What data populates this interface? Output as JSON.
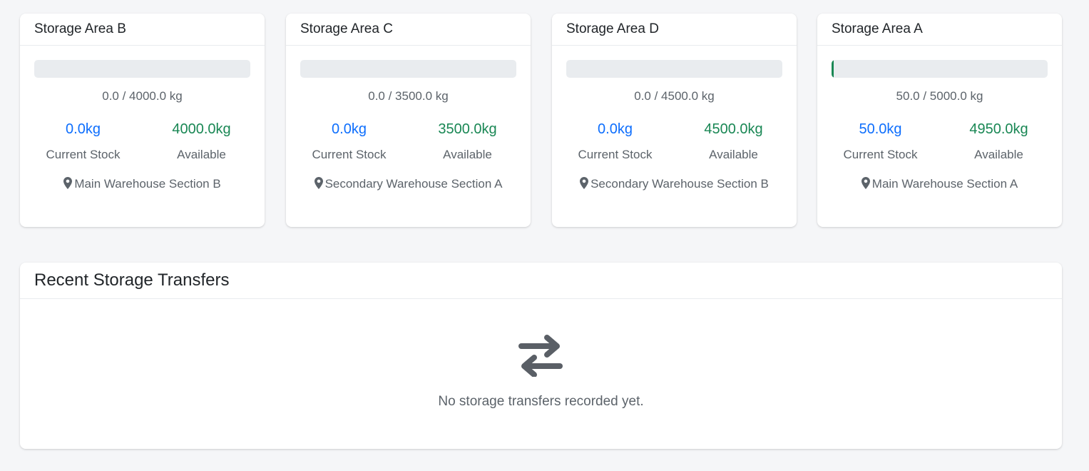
{
  "storage_areas": [
    {
      "name": "Storage Area B",
      "capacity_text": "0.0 / 4000.0 kg",
      "fill_fraction": 0.0,
      "current_stock": "0.0kg",
      "current_stock_label": "Current Stock",
      "available": "4000.0kg",
      "available_label": "Available",
      "location": "Main Warehouse Section B",
      "location_icon": "map-pin-icon"
    },
    {
      "name": "Storage Area C",
      "capacity_text": "0.0 / 3500.0 kg",
      "fill_fraction": 0.0,
      "current_stock": "0.0kg",
      "current_stock_label": "Current Stock",
      "available": "3500.0kg",
      "available_label": "Available",
      "location": "Secondary Warehouse Section A",
      "location_icon": "map-pin-icon"
    },
    {
      "name": "Storage Area D",
      "capacity_text": "0.0 / 4500.0 kg",
      "fill_fraction": 0.0,
      "current_stock": "0.0kg",
      "current_stock_label": "Current Stock",
      "available": "4500.0kg",
      "available_label": "Available",
      "location": "Secondary Warehouse Section B",
      "location_icon": "map-pin-icon"
    },
    {
      "name": "Storage Area A",
      "capacity_text": "50.0 / 5000.0 kg",
      "fill_fraction": 0.01,
      "current_stock": "50.0kg",
      "current_stock_label": "Current Stock",
      "available": "4950.0kg",
      "available_label": "Available",
      "location": "Main Warehouse Section A",
      "location_icon": "map-pin-icon"
    }
  ],
  "transfers": {
    "title": "Recent Storage Transfers",
    "empty_icon": "exchange-arrows-icon",
    "empty_message": "No storage transfers recorded yet."
  },
  "colors": {
    "stock_blue": "#0d6efd",
    "available_green": "#198754",
    "progress_track": "#e9ecef",
    "progress_fill": "#198754"
  }
}
